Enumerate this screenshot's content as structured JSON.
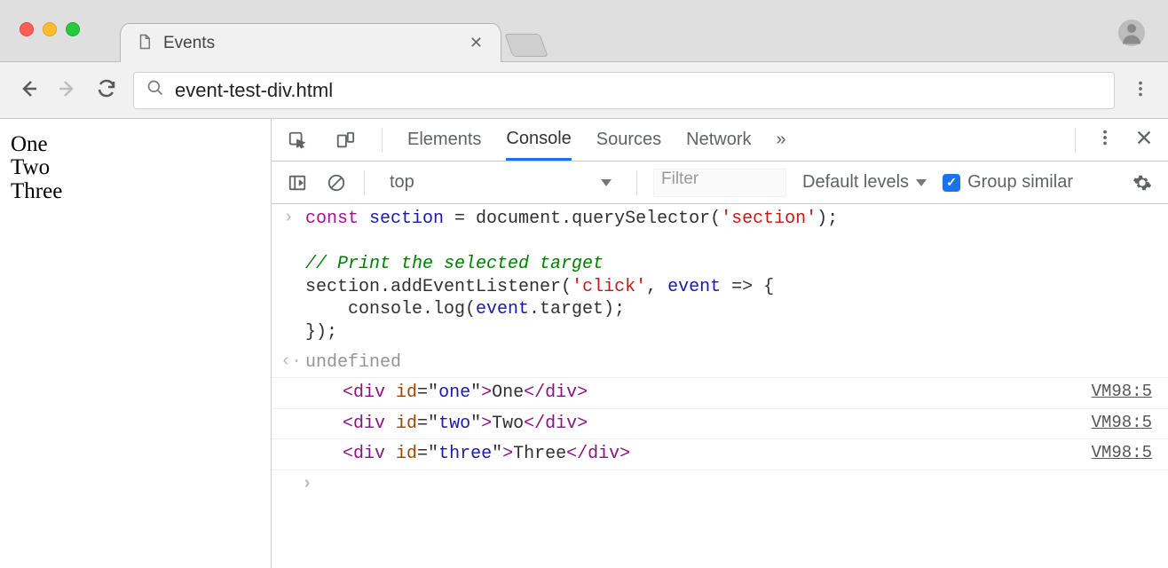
{
  "window": {
    "tab_title": "Events"
  },
  "toolbar": {
    "url": "event-test-div.html"
  },
  "page": {
    "items": [
      "One",
      "Two",
      "Three"
    ]
  },
  "devtools": {
    "tabs": {
      "elements": "Elements",
      "console": "Console",
      "sources": "Sources",
      "network": "Network"
    },
    "overflow": "»",
    "console_toolbar": {
      "context": "top",
      "filter_placeholder": "Filter",
      "levels_label": "Default levels",
      "group_similar_label": "Group similar"
    },
    "console": {
      "input_code": {
        "line1_kw": "const",
        "line1_ident": "section",
        "line1_rest_a": " = document.querySelector(",
        "line1_str": "'section'",
        "line1_rest_b": ");",
        "line2_comment": "// Print the selected target",
        "line3_a": "section.addEventListener(",
        "line3_str": "'click'",
        "line3_b": ", ",
        "line3_ident": "event",
        "line3_c": " => {",
        "line4": "    console.log(",
        "line4_ident": "event",
        "line4_b": ".target);",
        "line5": "});"
      },
      "return_value": "undefined",
      "logs": [
        {
          "id": "one",
          "text": "One",
          "source": "VM98:5"
        },
        {
          "id": "two",
          "text": "Two",
          "source": "VM98:5"
        },
        {
          "id": "three",
          "text": "Three",
          "source": "VM98:5"
        }
      ]
    }
  }
}
